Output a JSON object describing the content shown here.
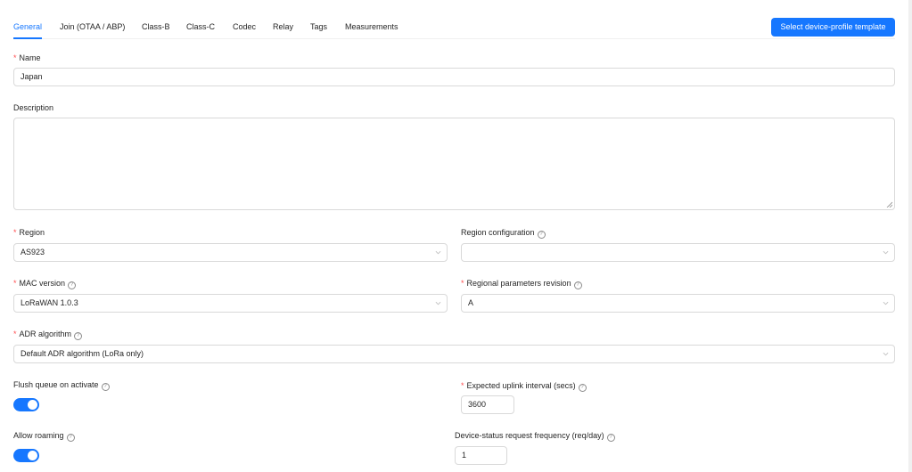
{
  "tabs": [
    {
      "label": "General",
      "active": true
    },
    {
      "label": "Join (OTAA / ABP)"
    },
    {
      "label": "Class-B"
    },
    {
      "label": "Class-C"
    },
    {
      "label": "Codec"
    },
    {
      "label": "Relay"
    },
    {
      "label": "Tags"
    },
    {
      "label": "Measurements"
    }
  ],
  "template_button": "Select device-profile template",
  "form": {
    "name": {
      "label": "Name",
      "value": "Japan",
      "required": true
    },
    "description": {
      "label": "Description",
      "value": ""
    },
    "region": {
      "label": "Region",
      "value": "AS923",
      "required": true
    },
    "region_config": {
      "label": "Region configuration",
      "value": ""
    },
    "mac_version": {
      "label": "MAC version",
      "value": "LoRaWAN 1.0.3",
      "required": true
    },
    "regional_params": {
      "label": "Regional parameters revision",
      "value": "A",
      "required": true
    },
    "adr": {
      "label": "ADR algorithm",
      "value": "Default ADR algorithm (LoRa only)",
      "required": true
    },
    "flush_queue": {
      "label": "Flush queue on activate",
      "checked": true
    },
    "uplink_interval": {
      "label": "Expected uplink interval (secs)",
      "value": "3600",
      "required": true
    },
    "allow_roaming": {
      "label": "Allow roaming",
      "checked": true
    },
    "status_freq": {
      "label": "Device-status request frequency (req/day)",
      "value": "1"
    }
  },
  "colors": {
    "accent": "#1677ff",
    "required": "#ff4d4f",
    "border": "#d9d9d9"
  }
}
